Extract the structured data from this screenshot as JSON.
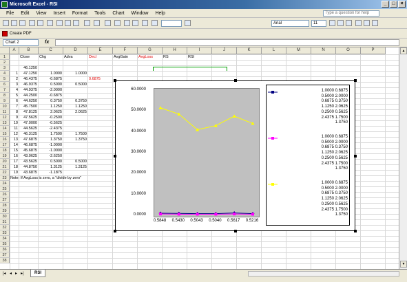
{
  "window": {
    "title": "Microsoft Excel - RSI"
  },
  "menu": [
    "File",
    "Edit",
    "View",
    "Insert",
    "Format",
    "Tools",
    "Chart",
    "Window",
    "Help"
  ],
  "help_placeholder": "Type a question for help",
  "toolbar": {
    "font": "Arial",
    "size": "11",
    "pdf_button": "Create PDF"
  },
  "name_box": "Chart 2",
  "fx": "fx",
  "columns": [
    "A",
    "B",
    "C",
    "D",
    "E",
    "F",
    "G",
    "H",
    "I",
    "J",
    "K",
    "L",
    "M",
    "N",
    "O",
    "P"
  ],
  "rows": [
    "1",
    "2",
    "3",
    "4",
    "5",
    "6",
    "7",
    "8",
    "9",
    "10",
    "11",
    "12",
    "13",
    "14",
    "15",
    "16",
    "17",
    "18",
    "19",
    "20",
    "21",
    "22",
    "23",
    "24",
    "25",
    "26",
    "27",
    "28",
    "29",
    "30",
    "31",
    "32",
    "33",
    "34",
    "35",
    "36",
    "37",
    "38"
  ],
  "headers": {
    "close": "Close",
    "chg": "Chg",
    "adva": "Adva",
    "decl": "Decl",
    "avggain": "AvgGain",
    "avgloss": "AvgLoss",
    "rs": "RS",
    "rsi": "RSI"
  },
  "sheet": {
    "a": [
      "",
      "",
      "1",
      "2",
      "3",
      "4",
      "5",
      "6",
      "7",
      "8",
      "9",
      "10",
      "11",
      "12",
      "13",
      "14",
      "15",
      "16",
      "17",
      "18",
      "19"
    ],
    "b": [
      "",
      "46.1250",
      "47.1250",
      "46.4375",
      "46.9375",
      "44.9375",
      "44.2500",
      "44.6250",
      "45.7500",
      "47.8125",
      "47.5625",
      "47.0000",
      "44.5625",
      "46.3125",
      "47.6875",
      "46.6875",
      "45.6875",
      "43.0625",
      "43.5625",
      "44.8750",
      "43.6875"
    ],
    "c": [
      "",
      "",
      "1.0000",
      "-0.6875",
      "0.5000",
      "-2.0000",
      "-0.6875",
      "0.3750",
      "1.1250",
      "2.0625",
      "-0.2500",
      "-0.5625",
      "-2.4375",
      "1.7500",
      "1.3750",
      "-1.0000",
      "-1.0000",
      "-2.6250",
      "0.5000",
      "1.3125",
      "-1.1875"
    ],
    "d": [
      "",
      "",
      "1.0000",
      "",
      "0.5000",
      "",
      "",
      "0.3750",
      "1.1250",
      "2.0625",
      "",
      "",
      "",
      "1.7500",
      "1.3750",
      "",
      "",
      "",
      "0.5000",
      "1.3125",
      ""
    ],
    "e4": "0.6875",
    "note": "Note: If AvgLoss is zero, a \"divide by zero\""
  },
  "chart_data": {
    "type": "line",
    "ylim": [
      0,
      60
    ],
    "yticks": [
      "0.0000",
      "10.0000",
      "20.0000",
      "30.0000",
      "40.0000",
      "50.0000",
      "60.0000"
    ],
    "categories": [
      "0.5848",
      "0.5430",
      "0.5043",
      "0.5040",
      "0.5617",
      "0.5216"
    ],
    "series": [
      {
        "color": "#000080",
        "marker": "diamond",
        "values": [
          1.0,
          0.9,
          0.8,
          0.8,
          1.1,
          0.8
        ]
      },
      {
        "color": "#ff00ff",
        "marker": "square",
        "values": [
          0.6,
          0.5,
          0.5,
          0.5,
          0.6,
          0.5
        ]
      },
      {
        "color": "#ffff00",
        "marker": "triangle",
        "values": [
          51.5,
          48.5,
          41.0,
          43.0,
          47.5,
          44.0
        ]
      }
    ],
    "legend": [
      {
        "color": "#000080",
        "lines": [
          "1.0000 0.6875",
          "0.5000 2.0000",
          "0.6875 0.3750",
          "1.1250 2.0625",
          "0.2500 0.5625",
          "2.4375 1.7500",
          "1.3750"
        ]
      },
      {
        "color": "#ff00ff",
        "lines": [
          "1.0000 0.6875",
          "0.5000 2.0000",
          "0.6875 0.3750",
          "1.1250 2.0625",
          "0.2500 0.5625",
          "2.4375 1.7500",
          "1.3750"
        ]
      },
      {
        "color": "#ffff00",
        "lines": [
          "1.0000 0.6875",
          "0.5000 2.0000",
          "0.6875 0.3750",
          "1.1250 2.0625",
          "0.2500 0.5625",
          "2.4375 1.7500",
          "1.3750"
        ]
      }
    ],
    "legend_position": "right",
    "grid": false
  },
  "tabs": {
    "sheet": "RSI"
  }
}
